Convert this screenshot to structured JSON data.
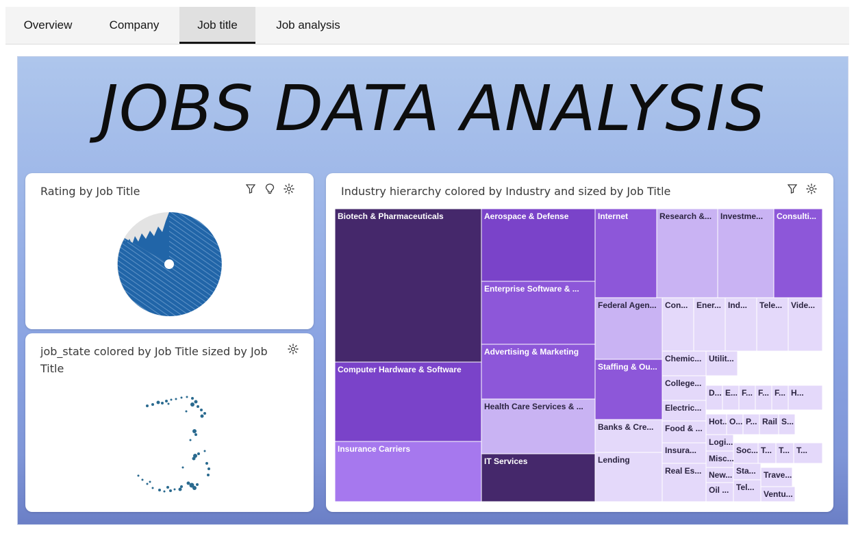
{
  "tabs": [
    {
      "label": "Overview"
    },
    {
      "label": "Company"
    },
    {
      "label": "Job title",
      "active": true
    },
    {
      "label": "Job analysis"
    }
  ],
  "dashboard": {
    "title": "JOBS DATA ANALYSIS"
  },
  "cards": {
    "rating": {
      "title": "Rating by Job Title",
      "icons": [
        "filter-icon",
        "lightbulb-icon",
        "settings-icon"
      ]
    },
    "job_state": {
      "title": "job_state colored by Job Title sized by Job Title",
      "icons": [
        "settings-icon"
      ]
    },
    "industry": {
      "title": "Industry hierarchy colored by Industry and sized by Job Title",
      "icons": [
        "filter-icon",
        "settings-icon"
      ]
    }
  },
  "chart_data": {
    "type": "treemap",
    "title": "Industry hierarchy colored by Industry and sized by Job Title",
    "nodes": [
      {
        "label": "Biotech & Pharmaceuticals"
      },
      {
        "label": "Computer Hardware & Software"
      },
      {
        "label": "Insurance Carriers"
      },
      {
        "label": "Aerospace & Defense"
      },
      {
        "label": "Enterprise Software & ..."
      },
      {
        "label": "Advertising & Marketing"
      },
      {
        "label": "Health Care Services & ..."
      },
      {
        "label": "IT Services"
      },
      {
        "label": "Internet"
      },
      {
        "label": "Research &..."
      },
      {
        "label": "Investme..."
      },
      {
        "label": "Consulti..."
      },
      {
        "label": "Federal Agen..."
      },
      {
        "label": "Staffing & Ou..."
      },
      {
        "label": "Banks & Cre..."
      },
      {
        "label": "Lending"
      },
      {
        "label": "Con..."
      },
      {
        "label": "Ener..."
      },
      {
        "label": "Ind..."
      },
      {
        "label": "Tele..."
      },
      {
        "label": "Vide..."
      },
      {
        "label": "Chemic..."
      },
      {
        "label": "Utilit..."
      },
      {
        "label": "College..."
      },
      {
        "label": "D..."
      },
      {
        "label": "E..."
      },
      {
        "label": "F..."
      },
      {
        "label": "F..."
      },
      {
        "label": "F..."
      },
      {
        "label": "H..."
      },
      {
        "label": "Electric..."
      },
      {
        "label": "Hot..."
      },
      {
        "label": "O..."
      },
      {
        "label": "P..."
      },
      {
        "label": "Rail"
      },
      {
        "label": "S..."
      },
      {
        "label": "Food & ..."
      },
      {
        "label": "Logi..."
      },
      {
        "label": "Soc..."
      },
      {
        "label": "T..."
      },
      {
        "label": "T..."
      },
      {
        "label": "T..."
      },
      {
        "label": "Insura..."
      },
      {
        "label": "Misc..."
      },
      {
        "label": "Sta..."
      },
      {
        "label": "New..."
      },
      {
        "label": "Trave..."
      },
      {
        "label": "Real Es..."
      },
      {
        "label": "Oil ..."
      },
      {
        "label": "Tel..."
      },
      {
        "label": "Ventu..."
      }
    ]
  },
  "colors": {
    "dark_purple": "#45286b",
    "purple": "#7a43c9",
    "medium_purple": "#8d57d9",
    "light_purple": "#a678ee",
    "lavender": "#c9b3f3",
    "pale_lavender": "#e4d9fa",
    "pie_blue": "#2165a8",
    "pie_grey": "#e3e3e3"
  }
}
